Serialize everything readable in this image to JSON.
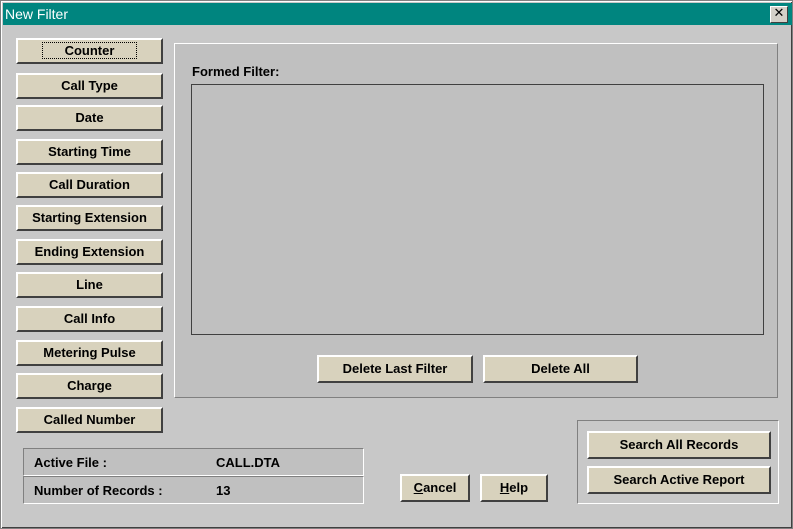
{
  "window": {
    "title": "New Filter",
    "close_glyph": "✕"
  },
  "fields": [
    "Counter",
    "Call Type",
    "Date",
    "Starting Time",
    "Call Duration",
    "Starting Extension",
    "Ending Extension",
    "Line",
    "Call Info",
    "Metering Pulse",
    "Charge",
    "Called Number"
  ],
  "filter": {
    "label": "Formed Filter:",
    "value": ""
  },
  "actions": {
    "delete_last": "Delete Last Filter",
    "delete_all": "Delete All",
    "cancel_u": "C",
    "cancel_rest": "ancel",
    "help_u": "H",
    "help_rest": "elp",
    "search_all": "Search All Records",
    "search_active": "Search Active Report"
  },
  "info": {
    "active_file_label": "Active File :",
    "active_file_value": "CALL.DTA",
    "records_label": "Number of Records :",
    "records_value": "13"
  }
}
